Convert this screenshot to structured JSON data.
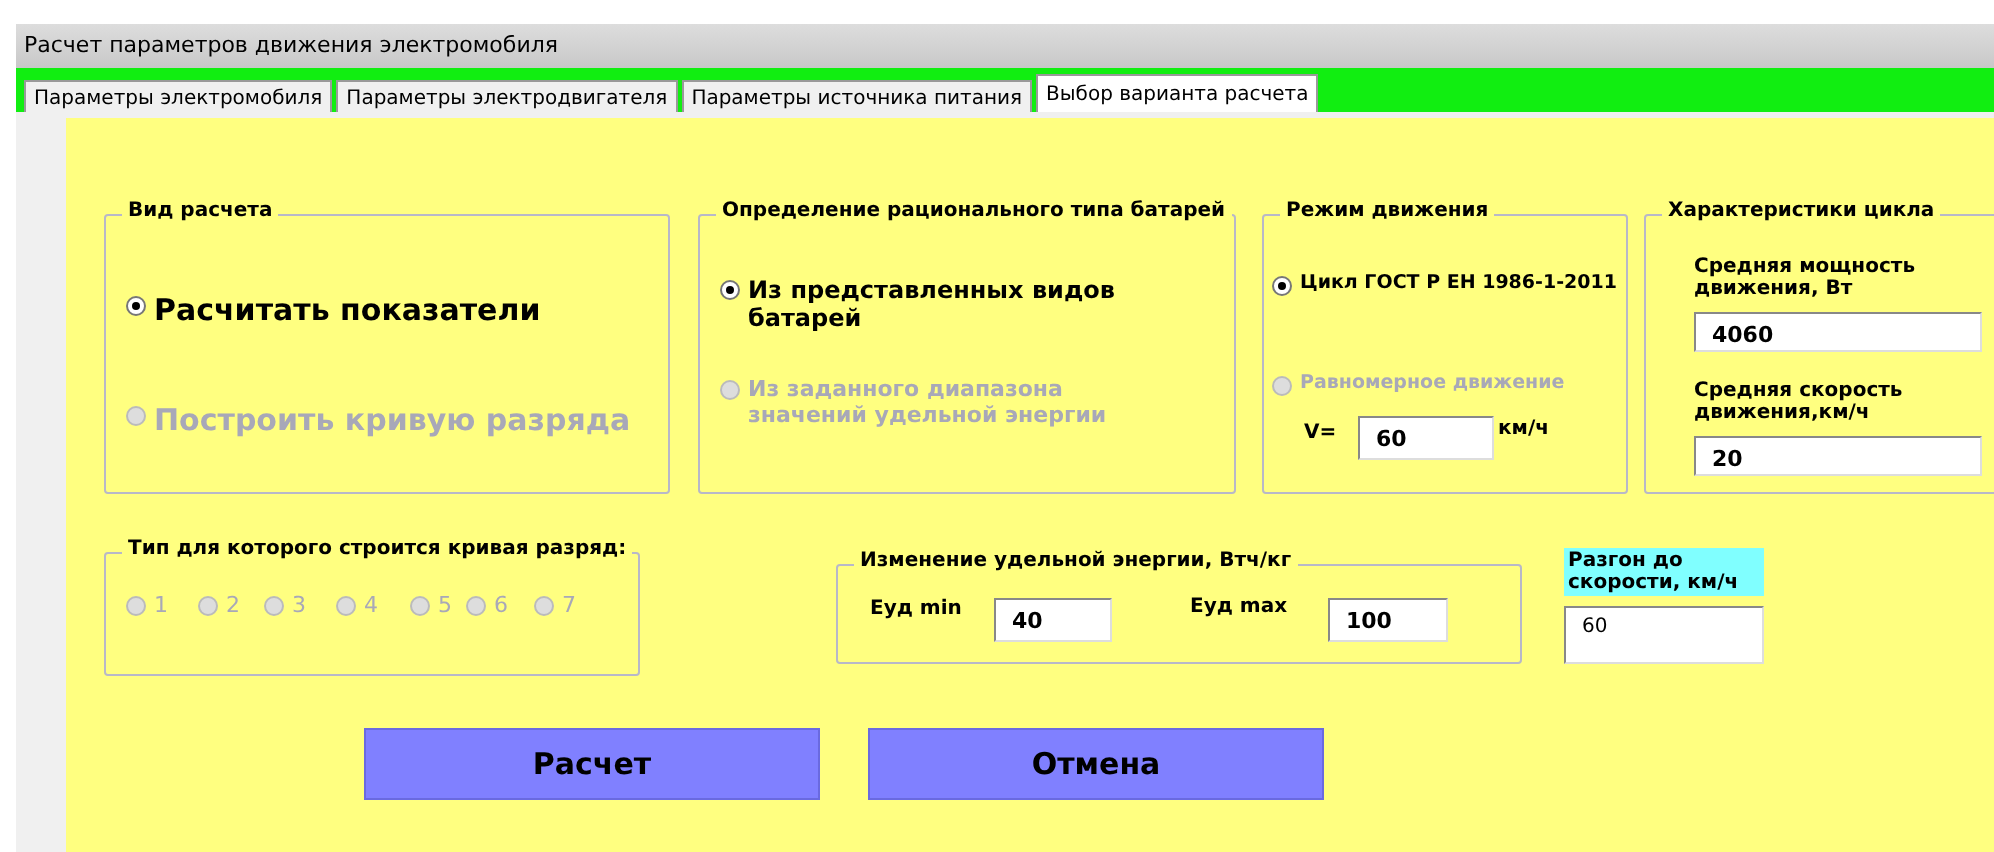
{
  "window": {
    "title": "Расчет параметров движения электромобиля"
  },
  "tabs": [
    {
      "label": "Параметры электромобиля",
      "selected": false
    },
    {
      "label": "Параметры электродвигателя",
      "selected": false
    },
    {
      "label": "Параметры источника питания",
      "selected": false
    },
    {
      "label": "Выбор варианта расчета",
      "selected": true
    }
  ],
  "calc_type": {
    "title": "Вид расчета",
    "options": [
      {
        "label": "Расчитать показатели",
        "selected": true,
        "disabled": false
      },
      {
        "label": "Построить кривую разряда",
        "selected": false,
        "disabled": true
      }
    ]
  },
  "battery_type": {
    "title": "Определение рационального типа батарей",
    "options": [
      {
        "label": "Из представленных видов батарей",
        "selected": true,
        "disabled": false
      },
      {
        "label": "Из заданного диапазона значений удельной энергии",
        "selected": false,
        "disabled": true
      }
    ]
  },
  "motion_mode": {
    "title": "Режим движения",
    "options": [
      {
        "label": "Цикл ГОСТ Р ЕН 1986-1-2011",
        "selected": true,
        "disabled": false
      },
      {
        "label": "Равномерное движение",
        "selected": false,
        "disabled": true
      }
    ],
    "speed_label": "V=",
    "speed_value": "60",
    "speed_unit": "км/ч"
  },
  "cycle": {
    "title": "Характеристики цикла",
    "fields": [
      {
        "label": "Средняя мощность движения, Вт",
        "value": "4060"
      },
      {
        "label": "Средняя скорость движения,км/ч",
        "value": "20"
      }
    ]
  },
  "curve_type": {
    "title": "Тип для которого строится кривая разряд:",
    "options": [
      {
        "label": "1",
        "selected": false,
        "disabled": true
      },
      {
        "label": "2",
        "selected": false,
        "disabled": true
      },
      {
        "label": "3",
        "selected": false,
        "disabled": true
      },
      {
        "label": "4",
        "selected": false,
        "disabled": true
      },
      {
        "label": "5",
        "selected": false,
        "disabled": true
      },
      {
        "label": "6",
        "selected": false,
        "disabled": true
      },
      {
        "label": "7",
        "selected": false,
        "disabled": true
      }
    ]
  },
  "energy": {
    "title": "Изменение удельной энергии, Втч/кг",
    "min_label": "Еуд min",
    "min_value": "40",
    "max_label": "Еуд max",
    "max_value": "100"
  },
  "acceleration": {
    "label": "Разгон до скорости, км/ч",
    "value": "60"
  },
  "buttons": [
    "Расчет",
    "Отмена"
  ]
}
